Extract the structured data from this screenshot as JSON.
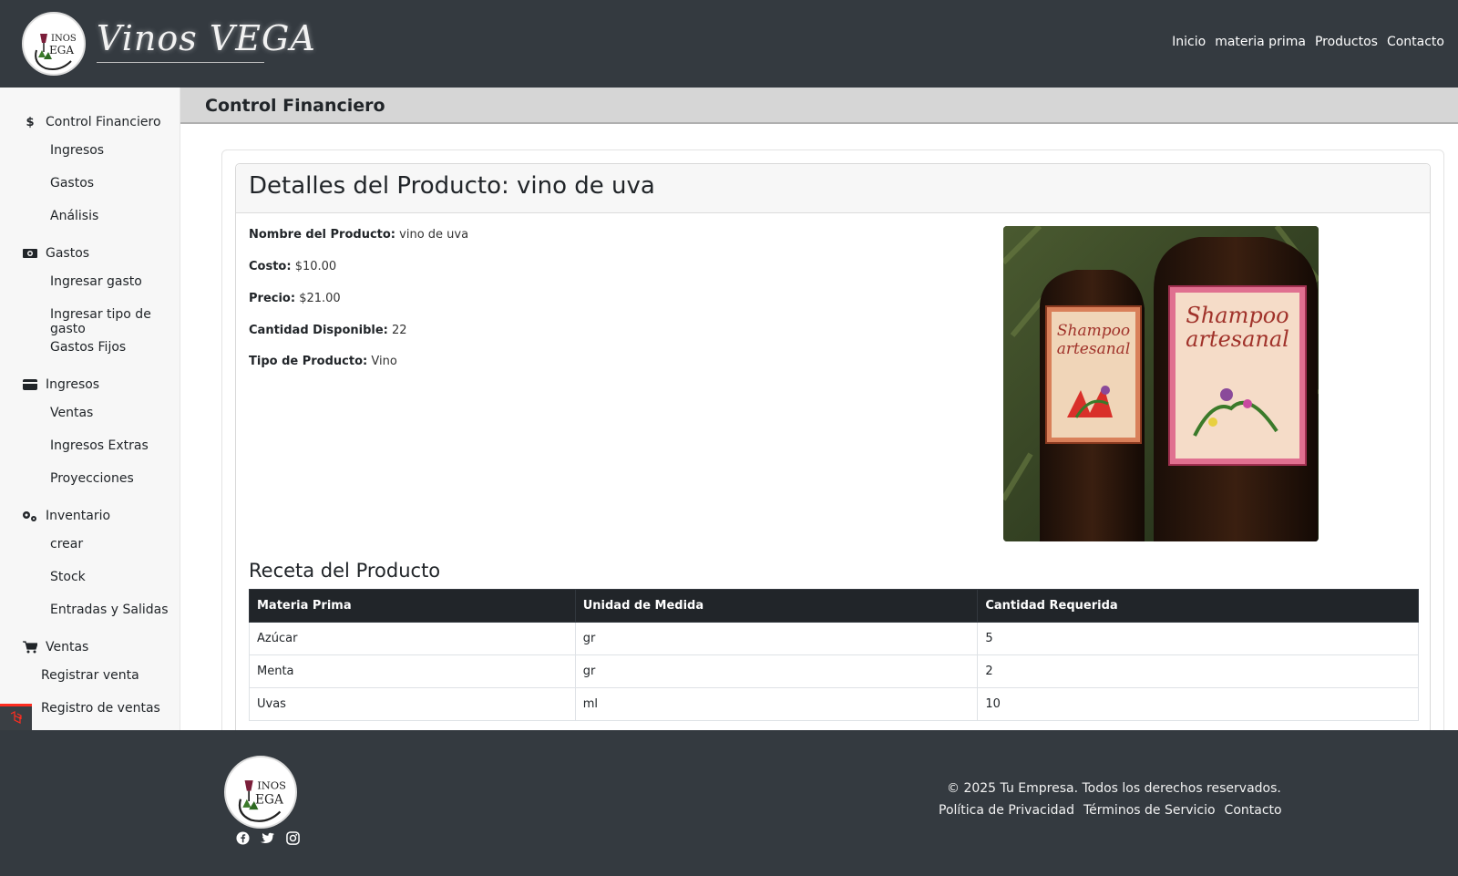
{
  "header": {
    "brand": "Vinos VEGA",
    "logo_text": "VINOS VEGA",
    "nav": [
      "Inicio",
      "materia prima",
      "Productos",
      "Contacto"
    ]
  },
  "sidebar": {
    "sections": [
      {
        "label": "Control Financiero",
        "icon": "dollar-icon",
        "items": [
          "Ingresos",
          "Gastos",
          "Análisis"
        ]
      },
      {
        "label": "Gastos",
        "icon": "money-icon",
        "items": [
          "Ingresar gasto",
          "Ingresar tipo de gasto",
          "Gastos Fijos"
        ]
      },
      {
        "label": "Ingresos",
        "icon": "credit-card-icon",
        "items": [
          "Ventas",
          "Ingresos Extras",
          "Proyecciones"
        ]
      },
      {
        "label": "Inventario",
        "icon": "cogs-icon",
        "items": [
          "crear",
          "Stock",
          "Entradas y Salidas"
        ]
      },
      {
        "label": "Ventas",
        "icon": "cart-icon",
        "items": [
          "Registrar venta",
          "Registro de ventas"
        ]
      }
    ]
  },
  "page": {
    "title": "Control Financiero",
    "card_title": "Detalles del Producto: vino de uva",
    "fields": [
      {
        "label": "Nombre del Producto:",
        "value": "vino de uva"
      },
      {
        "label": "Costo:",
        "value": "$10.00"
      },
      {
        "label": "Precio:",
        "value": "$21.00"
      },
      {
        "label": "Cantidad Disponible:",
        "value": "22"
      },
      {
        "label": "Tipo de Producto:",
        "value": "Vino"
      }
    ],
    "image_label_text": [
      "Shampoo",
      "artesanal"
    ],
    "recipe": {
      "title": "Receta del Producto",
      "columns": [
        "Materia Prima",
        "Unidad de Medida",
        "Cantidad Requerida"
      ],
      "rows": [
        [
          "Azúcar",
          "gr",
          "5"
        ],
        [
          "Menta",
          "gr",
          "2"
        ],
        [
          "Uvas",
          "ml",
          "10"
        ]
      ]
    }
  },
  "footer": {
    "logo_text": "VINOS VEGA",
    "copyright": "© 2025 Tu Empresa. Todos los derechos reservados.",
    "links": [
      "Política de Privacidad",
      "Términos de Servicio",
      "Contacto"
    ],
    "social_icons": [
      "facebook-icon",
      "twitter-icon",
      "instagram-icon"
    ]
  },
  "colors": {
    "topbar": "#343a40",
    "sidebar": "#f7f7f7",
    "table_header": "#212529",
    "page_header": "#d6d6d6"
  }
}
